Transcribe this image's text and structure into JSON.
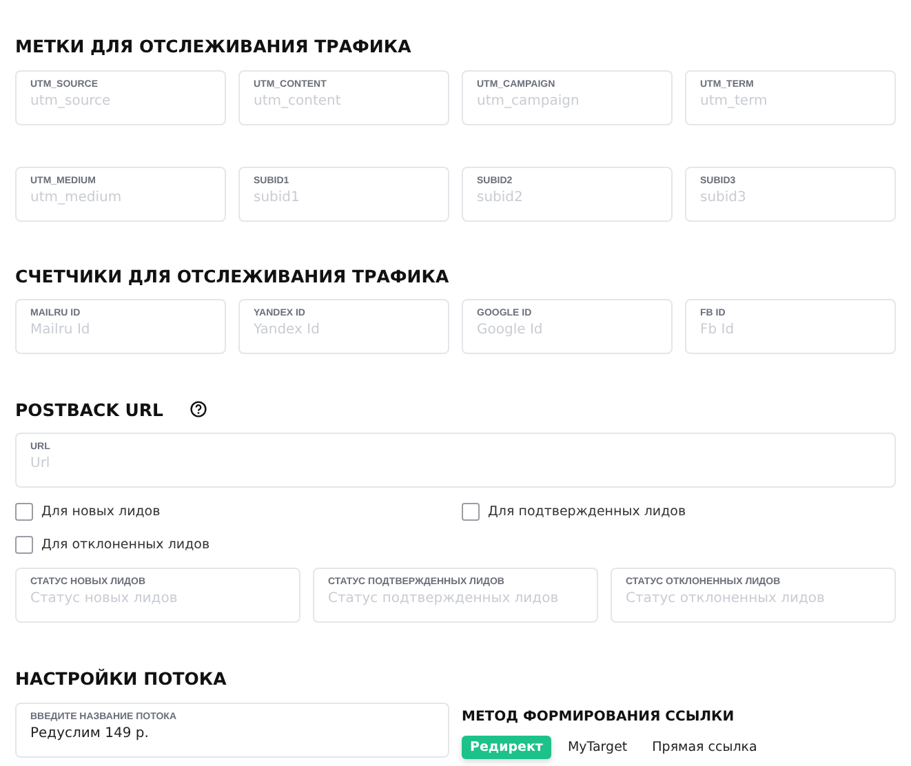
{
  "utm": {
    "title": "МЕТКИ ДЛЯ ОТСЛЕЖИВАНИЯ ТРАФИКА",
    "fields": [
      {
        "label": "UTM_SOURCE",
        "placeholder": "utm_source"
      },
      {
        "label": "UTM_CONTENT",
        "placeholder": "utm_content"
      },
      {
        "label": "UTM_CAMPAIGN",
        "placeholder": "utm_campaign"
      },
      {
        "label": "UTM_TERM",
        "placeholder": "utm_term"
      },
      {
        "label": "UTM_MEDIUM",
        "placeholder": "utm_medium"
      },
      {
        "label": "SUBID1",
        "placeholder": "subid1"
      },
      {
        "label": "SUBID2",
        "placeholder": "subid2"
      },
      {
        "label": "SUBID3",
        "placeholder": "subid3"
      }
    ]
  },
  "counters": {
    "title": "СЧЕТЧИКИ ДЛЯ ОТСЛЕЖИВАНИЯ ТРАФИКА",
    "fields": [
      {
        "label": "MAILRU ID",
        "placeholder": "Mailru Id"
      },
      {
        "label": "YANDEX ID",
        "placeholder": "Yandex Id"
      },
      {
        "label": "GOOGLE ID",
        "placeholder": "Google Id"
      },
      {
        "label": "FB ID",
        "placeholder": "Fb Id"
      }
    ]
  },
  "postback": {
    "title": "POSTBACK URL",
    "url": {
      "label": "URL",
      "placeholder": "Url"
    },
    "checkboxes": [
      {
        "label": "Для новых лидов",
        "checked": false
      },
      {
        "label": "Для подтвержденных лидов",
        "checked": false
      },
      {
        "label": "Для отклоненных лидов",
        "checked": false
      }
    ],
    "statuses": [
      {
        "label": "СТАТУС НОВЫХ ЛИДОВ",
        "placeholder": "Статус новых лидов"
      },
      {
        "label": "СТАТУС ПОДТВЕРЖДЕННЫХ ЛИДОВ",
        "placeholder": "Статус подтвержденных лидов"
      },
      {
        "label": "СТАТУС ОТКЛОНЕННЫХ ЛИДОВ",
        "placeholder": "Статус отклоненных лидов"
      }
    ]
  },
  "stream": {
    "title": "НАСТРОЙКИ ПОТОКА",
    "name_field": {
      "label": "ВВЕДИТЕ НАЗВАНИЕ ПОТОКА",
      "value": "Редуслим 149 р."
    },
    "link_method": {
      "title": "МЕТОД ФОРМИРОВАНИЯ ССЫЛКИ",
      "options": [
        {
          "label": "Редирект",
          "selected": true
        },
        {
          "label": "MyTarget",
          "selected": false
        },
        {
          "label": "Прямая ссылка",
          "selected": false
        }
      ]
    }
  }
}
